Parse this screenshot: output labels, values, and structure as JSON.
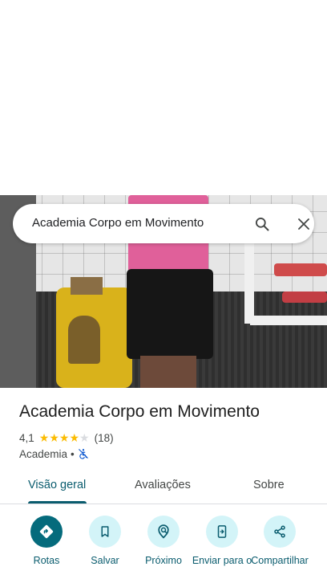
{
  "search": {
    "query": "Academia Corpo em Movimento"
  },
  "place": {
    "name": "Academia Corpo em Movimento",
    "rating": "4,1",
    "rating_value": 4.1,
    "rating_max": 5,
    "review_count": "(18)",
    "category": "Academia",
    "separator": "•",
    "wheelchair_icon": "not-accessible-icon"
  },
  "tabs": [
    {
      "label": "Visão geral",
      "active": true
    },
    {
      "label": "Avaliações",
      "active": false
    },
    {
      "label": "Sobre",
      "active": false
    }
  ],
  "actions": [
    {
      "label": "Rotas",
      "icon": "directions-icon",
      "primary": true
    },
    {
      "label": "Salvar",
      "icon": "bookmark-icon",
      "primary": false
    },
    {
      "label": "Próximo",
      "icon": "nearby-icon",
      "primary": false
    },
    {
      "label": "Enviar para o",
      "icon": "send-to-phone-icon",
      "primary": false
    },
    {
      "label": "Compartilhar",
      "icon": "share-icon",
      "primary": false
    }
  ],
  "colors": {
    "accent": "#0a5c6e",
    "action_primary": "#056b7c",
    "action_secondary": "#d3f4f8",
    "star": "#fbbc04"
  }
}
